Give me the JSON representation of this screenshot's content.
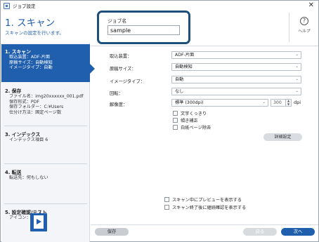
{
  "window": {
    "title": "ジョブ設定",
    "close_glyph": "✕"
  },
  "header": {
    "title": "1. スキャン",
    "subtitle": "スキャンの設定を行います。"
  },
  "sidebar": {
    "sections": [
      {
        "title": "1. スキャン",
        "lines": [
          "取込装置：ADF-片面",
          "原稿サイズ：自動検知",
          "イメージタイプ：自動"
        ],
        "active": true
      },
      {
        "title": "2. 保存",
        "lines": [
          "ファイル名：img20xxxxxx_001.pdf",
          "保存形式：PDF",
          "保存フォルダー：C:¥Users",
          "仕分け方法：固定ページ数"
        ],
        "active": false
      },
      {
        "title": "3. インデックス",
        "lines": [
          "インデックス項目 6"
        ],
        "active": false
      },
      {
        "title": "4. 転送",
        "lines": [
          "転送先：何もしない"
        ],
        "active": false
      },
      {
        "title": "5. 設定確認/テスト",
        "lines": [
          "アイコン："
        ],
        "active": false
      }
    ],
    "icon_name": "job-play-icon"
  },
  "job": {
    "label": "ジョブ名",
    "value": "sample"
  },
  "help": {
    "label": "ヘルプ",
    "glyph": "?"
  },
  "form": {
    "source": {
      "label": "取込装置：",
      "value": "ADF-片面"
    },
    "size": {
      "label": "原稿サイズ：",
      "value": "自動検知"
    },
    "image_type": {
      "label": "イメージタイプ：",
      "value": "自動"
    },
    "rotation": {
      "label": "回転：",
      "value": "なし"
    },
    "resolution": {
      "label": "解像度：",
      "value": "標準 (300dpi)",
      "spin_value": "300",
      "unit": "dpi"
    },
    "checks": [
      "文字くっきり",
      "傾き補正",
      "白紙ページ除去"
    ],
    "detail_button": "詳細設定",
    "bottom_checks": [
      "スキャン中にプレビューを表示する",
      "スキャン終了後に継続確認を表示する"
    ]
  },
  "footer": {
    "save": "保存",
    "back": "戻る",
    "next": "次へ"
  },
  "colors": {
    "accent": "#1f5fae",
    "highlight_border": "#1d4f7a"
  }
}
